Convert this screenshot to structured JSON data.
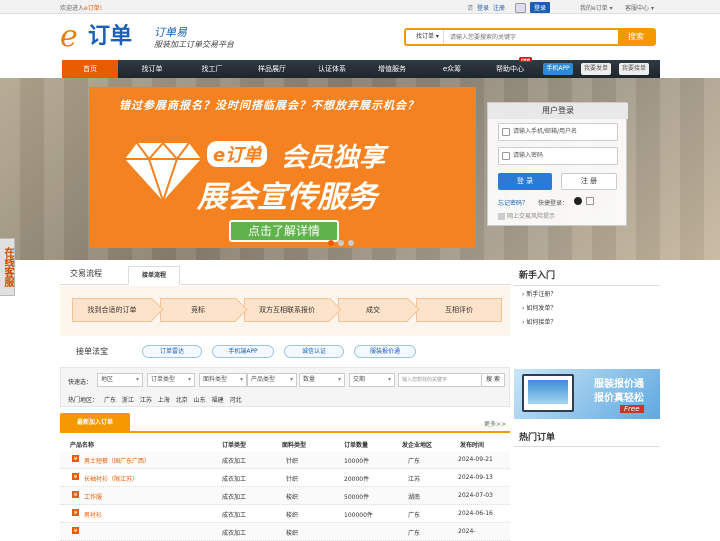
{
  "topbar": {
    "welcome": "欢迎进入",
    "brand": "e订单!",
    "login": "登录",
    "register": "注册",
    "reg_button": "登录",
    "my_orders": "我的e订单",
    "service": "客服中心"
  },
  "logo": {
    "e": "e",
    "name": "订单",
    "brand": "订单易",
    "slogan": "服装加工订单交易平台"
  },
  "search": {
    "category": "找订单",
    "placeholder": "请输入您要搜索的关键字",
    "button": "搜索"
  },
  "nav": {
    "items": [
      "首页",
      "找订单",
      "找工厂",
      "样品展厅",
      "认证体系",
      "增值服务",
      "e众筹",
      "帮助中心"
    ],
    "hot_badge": "new",
    "pills": [
      "手机APP",
      "我要发单",
      "我要接单"
    ]
  },
  "banner": {
    "question": "错过参展商报名？没时间搭临展会？不想放弃展示机会？",
    "tag": "e订单",
    "line1": "会员独享",
    "line2": "展会宣传服务",
    "cta": "点击了解详情"
  },
  "login": {
    "title": "用户登录",
    "username_placeholder": "请输入手机/邮箱/用户名",
    "password_placeholder": "请输入密码",
    "login_button": "登 录",
    "register_button": "注 册",
    "forgot": "忘记密码？",
    "quick": "快捷登录：",
    "note": "网上交易风险提示"
  },
  "side_tab": "在线客服",
  "tabs": {
    "flow": "交易流程",
    "receive": "接单流程"
  },
  "flow_steps": [
    "找到合适的订单",
    "竞标",
    "双方互相联系报价",
    "成交",
    "互相评价"
  ],
  "tools": {
    "label": "接单法宝",
    "pills": [
      "订单雷达",
      "手机端APP",
      "诚信认证",
      "服装报价通"
    ]
  },
  "filter": {
    "label": "快速选：",
    "selects": [
      "地区",
      "订单类型",
      "面料类型",
      "产品类型",
      "数量",
      "交期"
    ],
    "keyword_placeholder": "输入您想找的关键字",
    "search_button": "搜 索",
    "hot_area_label": "热门地区：",
    "areas": [
      "广东",
      "浙江",
      "江苏",
      "上海",
      "北京",
      "山东",
      "福建",
      "河北"
    ]
  },
  "list": {
    "title": "最新加入订单",
    "more": "更多>>",
    "icon": "单",
    "columns": [
      "产品名称",
      "订单类型",
      "面料类型",
      "订单数量",
      "发企业地区",
      "发布时间"
    ],
    "rows": [
      {
        "name": "男士短裤（国广东广西）",
        "type": "成衣加工",
        "fabric": "针织",
        "qty": "10000件",
        "area": "广东",
        "date": "2024-09-21"
      },
      {
        "name": "长袖衬衫（限江苏）",
        "type": "成衣加工",
        "fabric": "针织",
        "qty": "20000件",
        "area": "江苏",
        "date": "2024-09-13"
      },
      {
        "name": "工作服",
        "type": "成衣加工",
        "fabric": "梭织",
        "qty": "50000件",
        "area": "湖南",
        "date": "2024-07-03"
      },
      {
        "name": "男衬衫",
        "type": "成衣加工",
        "fabric": "梭织",
        "qty": "100000件",
        "area": "广东",
        "date": "2024-06-16"
      },
      {
        "name": "",
        "type": "成衣加工",
        "fabric": "梭织",
        "qty": "",
        "area": "广东",
        "date": "2024-"
      }
    ]
  },
  "newbie": {
    "title": "新手入门",
    "items": [
      "新手注册？",
      "如何发单？",
      "如何接单？"
    ]
  },
  "ad": {
    "line1": "服装报价通",
    "line2": "报价真轻松",
    "free": "Free"
  },
  "hot_orders": "热门订单"
}
